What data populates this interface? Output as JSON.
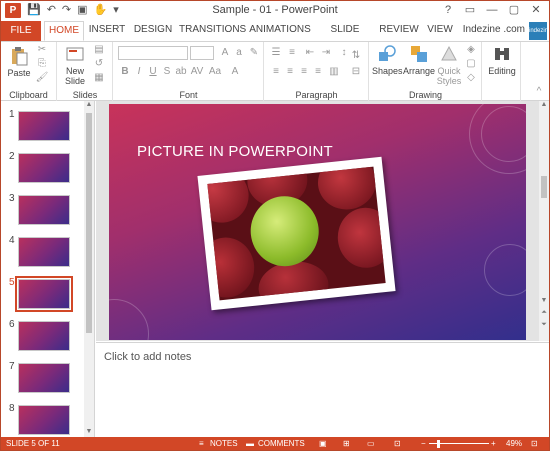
{
  "titlebar": {
    "title": "Sample - 01 - PowerPoint",
    "app_icon": "P",
    "controls": [
      "?",
      "▭",
      "—",
      "▢",
      "✕"
    ]
  },
  "tabs": [
    {
      "label": "FILE"
    },
    {
      "label": "HOME"
    },
    {
      "label": "INSERT"
    },
    {
      "label": "DESIGN"
    },
    {
      "label": "TRANSITIONS"
    },
    {
      "label": "ANIMATIONS"
    },
    {
      "label": "SLIDE SHOW"
    },
    {
      "label": "REVIEW"
    },
    {
      "label": "VIEW"
    }
  ],
  "user": {
    "name": "Indezine .com",
    "avatar_text": "indezine"
  },
  "ribbon": {
    "clipboard": {
      "label": "Clipboard",
      "paste": "Paste"
    },
    "slides": {
      "label": "Slides",
      "new_slide_1": "New",
      "new_slide_2": "Slide"
    },
    "font": {
      "label": "Font"
    },
    "paragraph": {
      "label": "Paragraph"
    },
    "drawing": {
      "label": "Drawing",
      "shapes": "Shapes",
      "arrange": "Arrange",
      "quick_styles_1": "Quick",
      "quick_styles_2": "Styles"
    },
    "editing": {
      "label": "Editing"
    }
  },
  "thumbnails": [
    {
      "num": "1"
    },
    {
      "num": "2"
    },
    {
      "num": "3"
    },
    {
      "num": "4"
    },
    {
      "num": "5",
      "selected": true
    },
    {
      "num": "6"
    },
    {
      "num": "7"
    },
    {
      "num": "8"
    }
  ],
  "slide": {
    "title": "PICTURE IN POWERPOINT"
  },
  "notes": {
    "placeholder": "Click to add notes"
  },
  "status": {
    "slide_info": "SLIDE 5 OF 11",
    "notes_btn": "NOTES",
    "comments_btn": "COMMENTS",
    "zoom": "49%"
  },
  "colors": {
    "accent": "#d24726"
  }
}
